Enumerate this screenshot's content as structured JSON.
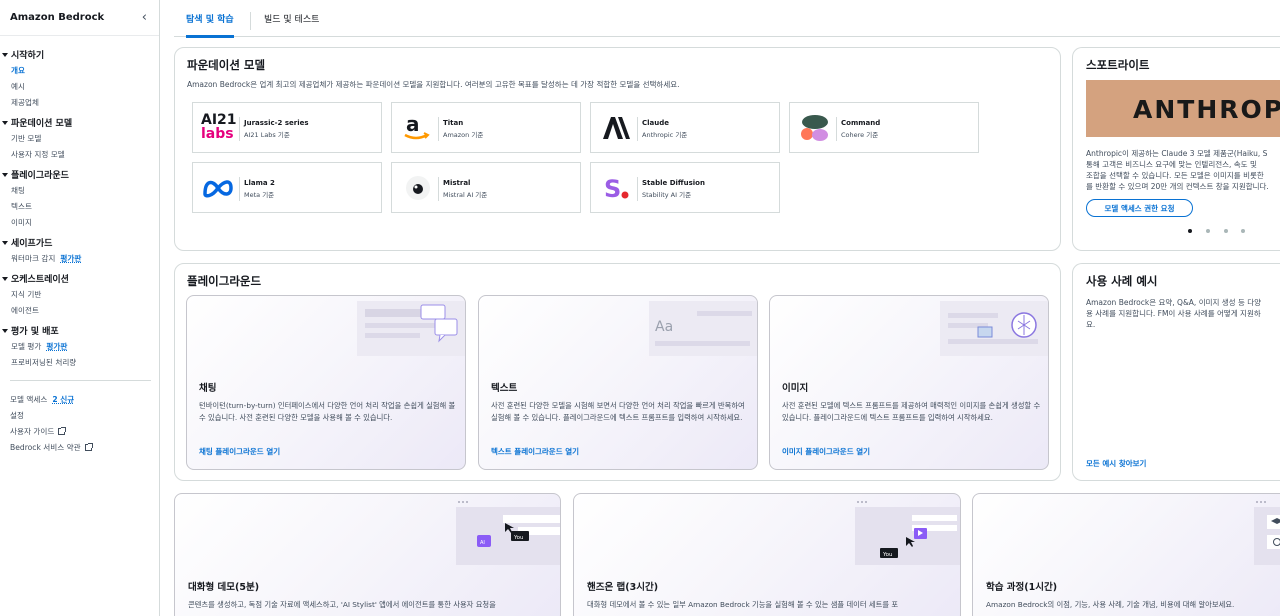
{
  "sidebar": {
    "title": "Amazon Bedrock",
    "sections": [
      {
        "title": "시작하기",
        "items": [
          "개요",
          "예시",
          "제공업체"
        ]
      },
      {
        "title": "파운데이션 모델",
        "items": [
          "기반 모델",
          "사용자 지정 모델"
        ]
      },
      {
        "title": "플레이그라운드",
        "items": [
          "채팅",
          "텍스트",
          "이미지"
        ]
      },
      {
        "title": "세이프가드",
        "items": [
          "워터마크 감지"
        ]
      },
      {
        "title": "오케스트레이션",
        "items": [
          "지식 기반",
          "에이전트"
        ]
      },
      {
        "title": "평가 및 배포",
        "items": [
          "모델 평가",
          "프로비저닝된 처리량"
        ]
      }
    ],
    "badge_preview": "평가판",
    "footer": {
      "model_access": "모델 액세스",
      "model_access_badge": "2 신규",
      "settings": "설정",
      "user_guide": "사용자 가이드",
      "service_terms": "Bedrock 서비스 약관"
    }
  },
  "tabs": [
    "탐색 및 학습",
    "빌드 및 테스트"
  ],
  "foundation": {
    "title": "파운데이션 모델",
    "desc": "Amazon Bedrock은 업계 최고의 제공업체가 제공하는 파운데이션 모델을 지원합니다. 여러분의 고유한 목표를 달성하는 데 가장 적합한 모델을 선택하세요.",
    "models": [
      {
        "name": "Jurassic-2 series",
        "provider": "AI21 Labs 기준"
      },
      {
        "name": "Titan",
        "provider": "Amazon 기준"
      },
      {
        "name": "Claude",
        "provider": "Anthropic 기준"
      },
      {
        "name": "Command",
        "provider": "Cohere 기준"
      },
      {
        "name": "Llama 2",
        "provider": "Meta 기준"
      },
      {
        "name": "Mistral",
        "provider": "Mistral AI 기준"
      },
      {
        "name": "Stable Diffusion",
        "provider": "Stability AI 기준"
      }
    ],
    "logo_text": {
      "ai21": "AI21",
      "labs": "labs"
    }
  },
  "spotlight": {
    "title": "스포트라이트",
    "banner": "ANTHROPIC",
    "desc": [
      "Anthropic이 제공하는 Claude 3 모델 제품군(Haiku, S",
      "통해 고객은 비즈니스 요구에 맞는 인텔리전스, 속도 및",
      "조합을 선택할 수 있습니다. 모든 모델은 이미지를 비롯한",
      "를 반환할 수 있으며 20만 개의 컨텍스트 창을 지원합니다."
    ],
    "button": "모델 액세스 권한 요청"
  },
  "playground": {
    "title": "플레이그라운드",
    "cards": [
      {
        "title": "채팅",
        "desc": "턴바이턴(turn-by-turn) 인터페이스에서 다양한 언어 처리 작업을 손쉽게 실험해 볼 수 있습니다. 사전 훈련된 다양한 모델을 사용해 볼 수 있습니다.",
        "link": "채팅 플레이그라운드 열기"
      },
      {
        "title": "텍스트",
        "desc": "사전 훈련된 다양한 모델을 시험해 보면서 다양한 언어 처리 작업을 빠르게 반복하여 실험해 볼 수 있습니다. 플레이그라운드에 텍스트 프롬프트를 입력하여 시작하세요.",
        "link": "텍스트 플레이그라운드 열기"
      },
      {
        "title": "이미지",
        "desc": "사전 훈련된 모델에 텍스트 프롬프트를 제공하여 매력적인 이미지를 손쉽게 생성할 수 있습니다. 플레이그라운드에 텍스트 프롬프트를 입력하여 시작하세요.",
        "link": "이미지 플레이그라운드 열기"
      }
    ],
    "illus_text": "Aa"
  },
  "use_cases": {
    "title": "사용 사례 예시",
    "desc": [
      "Amazon Bedrock은 요약, Q&A, 이미지 생성 등 다양",
      "용 사례를 지원합니다. FM이 사용 사례를 어떻게 지원하",
      "요."
    ],
    "link": "모든 예시 찾아보기"
  },
  "bottom_cards": [
    {
      "title": "대화형 데모(5분)",
      "desc": "콘텐츠를 생성하고, 독점 기술 자료에 액세스하고, 'AI Stylist' 앱에서 에이전트를 통한 사용자 요청을",
      "you": "You",
      "ai": "AI"
    },
    {
      "title": "핸즈온 랩(3시간)",
      "desc": "대화형 데모에서 볼 수 있는 일부 Amazon Bedrock 기능을 실험해 볼 수 있는 샘플 데이터 세트를 포",
      "you": "You"
    },
    {
      "title": "학습 과정(1시간)",
      "desc": "Amazon Bedrock의 이점, 기능, 사용 사례, 기술 개념, 비용에 대해 알아보세요."
    }
  ],
  "colors": {
    "accent": "#0972d3",
    "text": "#16191f",
    "muted": "#414d5c",
    "border": "#d5dbdb",
    "anthropic_bg": "#d4a27f"
  }
}
